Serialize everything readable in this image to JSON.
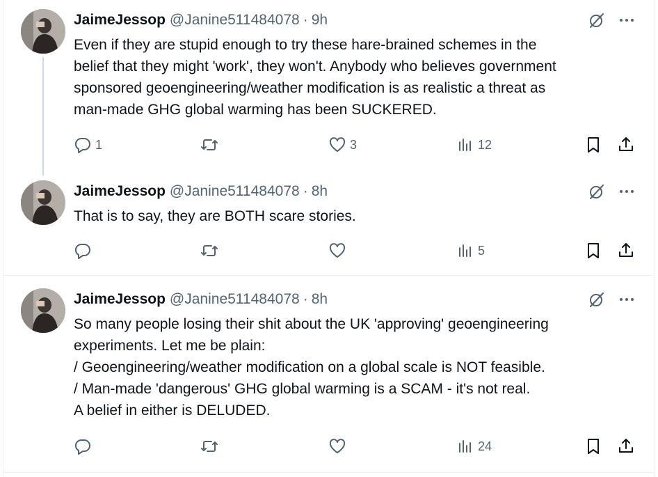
{
  "tweets": [
    {
      "name": "JaimeJessop",
      "handle": "@Janine511484078",
      "separator": "·",
      "time": "9h",
      "lines": [
        "Even if they are stupid enough to try these hare-brained schemes in the",
        "belief that they might 'work', they won't. Anybody who believes government",
        "sponsored geoengineering/weather modification is as realistic a  threat as",
        "man-made GHG global warming has been SUCKERED."
      ],
      "replies": "1",
      "retweets": "",
      "likes": "3",
      "views": "12"
    },
    {
      "name": "JaimeJessop",
      "handle": "@Janine511484078",
      "separator": "·",
      "time": "8h",
      "lines": [
        "That is to say, they are BOTH scare stories."
      ],
      "replies": "",
      "retweets": "",
      "likes": "",
      "views": "5"
    },
    {
      "name": "JaimeJessop",
      "handle": "@Janine511484078",
      "separator": "·",
      "time": "8h",
      "lines": [
        "So many people losing their shit about the UK 'approving' geoengineering",
        "experiments. Let me be plain:",
        "/ Geoengineering/weather modification on a global scale is NOT feasible.",
        "/ Man-made 'dangerous' GHG global warming is a SCAM - it's not real.",
        "A belief in either is DELUDED."
      ],
      "replies": "",
      "retweets": "",
      "likes": "",
      "views": "24"
    }
  ],
  "icons": {
    "reply": "reply-icon",
    "retweet": "retweet-icon",
    "like": "heart-icon",
    "views": "views-icon",
    "bookmark": "bookmark-icon",
    "share": "share-icon",
    "grok": "grok-icon",
    "more": "more-icon"
  },
  "colors": {
    "text": "#0f1419",
    "secondary": "#536471",
    "divider": "#eff3f4",
    "thread_line": "#cfd9de"
  }
}
